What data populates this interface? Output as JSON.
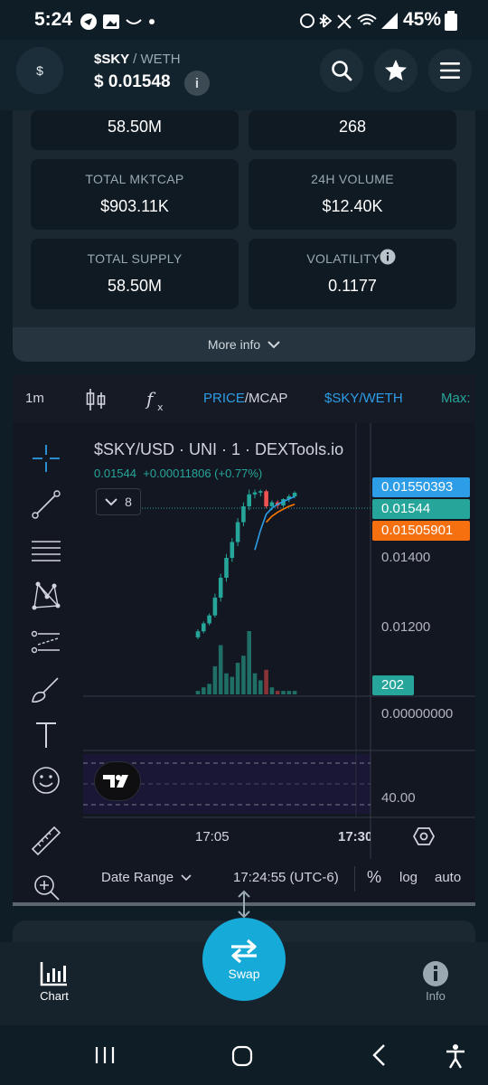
{
  "status_bar": {
    "time": "5:24",
    "battery": "45%"
  },
  "header": {
    "coin_symbol": "$",
    "pair_base": "$SKY",
    "pair_quote": "WETH",
    "price": "$  0.01548",
    "info": "i"
  },
  "stats": {
    "cards": [
      {
        "label": "",
        "value": "58.50M"
      },
      {
        "label": "",
        "value": "268"
      },
      {
        "label": "TOTAL MKTCAP",
        "value": "$903.11K"
      },
      {
        "label": "24H VOLUME",
        "value": "$12.40K"
      },
      {
        "label": "TOTAL SUPPLY",
        "value": "58.50M"
      },
      {
        "label": "VOLATILITY",
        "value": "0.1177"
      }
    ],
    "more_info": "More info"
  },
  "chart_toolbar": {
    "interval": "1m",
    "price_label": "PRICE",
    "mcap_label": "MCAP",
    "pair_label": "$SKY/WETH",
    "max_label": "Max:"
  },
  "chart": {
    "title": "$SKY/USD · UNI · 1 · DEXTools.io",
    "last": "0.01544",
    "change": "+0.00011806 (+0.77%)",
    "indicators_count": "8",
    "tags": {
      "high": "0.01550393",
      "last": "0.01544",
      "low": "0.01505901",
      "volume": "202"
    },
    "axis": {
      "p1": "0.01400",
      "p2": "0.01200",
      "v0": "0.00000000",
      "ind": "40.00"
    },
    "time_labels": [
      "17:05",
      "17:30"
    ],
    "date_range": "Date Range",
    "clock": "17:24:55 (UTC-6)",
    "pct": "%",
    "log": "log",
    "auto": "auto",
    "tv_logo": "TV"
  },
  "chart_data": {
    "type": "candlestick",
    "candles": [
      [
        0.0118,
        0.01195,
        0.01175,
        0.012,
        "up"
      ],
      [
        0.01195,
        0.01215,
        0.0119,
        0.0122,
        "up"
      ],
      [
        0.01215,
        0.01235,
        0.0121,
        0.0124,
        "up"
      ],
      [
        0.01235,
        0.0128,
        0.0123,
        0.0129,
        "up"
      ],
      [
        0.0128,
        0.0133,
        0.0127,
        0.0134,
        "up"
      ],
      [
        0.0133,
        0.0138,
        0.0132,
        0.0139,
        "up"
      ],
      [
        0.0138,
        0.0142,
        0.0137,
        0.0143,
        "up"
      ],
      [
        0.0142,
        0.0147,
        0.0141,
        0.0148,
        "up"
      ],
      [
        0.0147,
        0.0151,
        0.0146,
        0.0152,
        "up"
      ],
      [
        0.0151,
        0.0154,
        0.015,
        0.01552,
        "up"
      ],
      [
        0.0154,
        0.01545,
        0.0153,
        0.01552,
        "up"
      ],
      [
        0.01545,
        0.01548,
        0.01535,
        0.01552,
        "up"
      ],
      [
        0.01548,
        0.0151,
        0.01505,
        0.01552,
        "down"
      ],
      [
        0.0151,
        0.0152,
        0.015,
        0.01525,
        "up"
      ],
      [
        0.0152,
        0.01512,
        0.01505,
        0.01525,
        "down"
      ],
      [
        0.01512,
        0.01528,
        0.01508,
        0.0153,
        "up"
      ],
      [
        0.01528,
        0.01535,
        0.0152,
        0.0154,
        "up"
      ],
      [
        0.01535,
        0.01544,
        0.0153,
        0.01548,
        "up"
      ]
    ],
    "volume": [
      1,
      2,
      3,
      8,
      14,
      6,
      5,
      9,
      11,
      18,
      6,
      4,
      7,
      2,
      1,
      1,
      1,
      1
    ],
    "ma_fast": [
      null,
      null,
      null,
      null,
      null,
      null,
      null,
      null,
      null,
      null,
      0.014,
      0.0145,
      0.0149,
      0.01505,
      0.01515,
      0.01522,
      0.01528,
      0.01535
    ],
    "ma_slow": [
      null,
      null,
      null,
      null,
      null,
      null,
      null,
      null,
      null,
      null,
      null,
      null,
      0.0147,
      0.01485,
      0.01495,
      0.01503,
      0.0151,
      0.01515
    ]
  },
  "bottom_nav": {
    "chart_label": "Chart",
    "swap_label": "Swap",
    "info_label": "Info"
  }
}
